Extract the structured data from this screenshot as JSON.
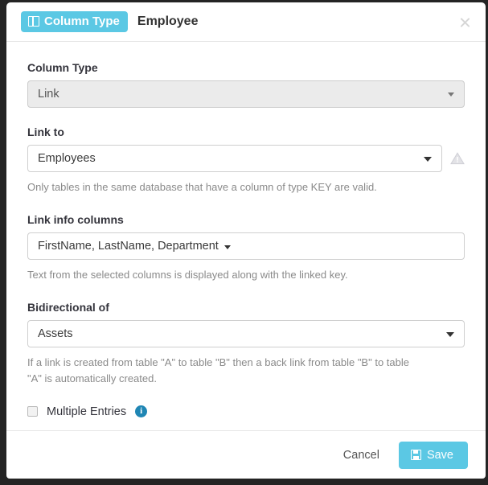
{
  "modal": {
    "header": {
      "badge_label": "Column Type",
      "badge_icon": "columns-icon",
      "title": "Employee",
      "close_icon": "close-icon"
    },
    "fields": {
      "column_type": {
        "label": "Column Type",
        "value": "Link",
        "disabled": true,
        "caret_icon": "chevron-down-icon"
      },
      "link_to": {
        "label": "Link to",
        "value": "Employees",
        "caret_icon": "chevron-down-icon",
        "warning_icon": "warning-triangle-icon",
        "help": "Only tables in the same database that have a column of type KEY are valid."
      },
      "link_info_columns": {
        "label": "Link info columns",
        "value": "FirstName, LastName, Department",
        "caret_icon": "chevron-down-icon",
        "help": "Text from the selected columns is displayed along with the linked key."
      },
      "bidirectional_of": {
        "label": "Bidirectional of",
        "value": "Assets",
        "caret_icon": "chevron-down-icon",
        "help": "If a link is created from table \"A\" to table \"B\" then a back link from table \"B\" to table \"A\" is automatically created."
      },
      "multiple_entries": {
        "label": "Multiple Entries",
        "checked": false,
        "info_icon": "info-icon",
        "info_glyph": "i"
      }
    },
    "footer": {
      "cancel_label": "Cancel",
      "save_label": "Save",
      "save_icon": "save-floppy-icon"
    }
  },
  "colors": {
    "accent": "#5bc8e4",
    "info": "#1f86b4",
    "text": "#34343c",
    "muted": "#8a8a8a",
    "border": "#cfcfcf",
    "backdrop": "#242424"
  }
}
